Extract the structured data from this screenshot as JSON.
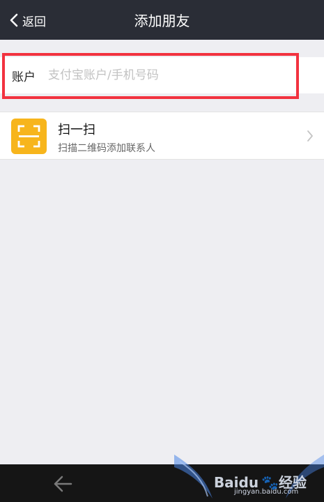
{
  "header": {
    "back_label": "返回",
    "title": "添加朋友"
  },
  "account": {
    "label": "账户",
    "placeholder": "支付宝账户/手机号码",
    "value": ""
  },
  "scan": {
    "title": "扫一扫",
    "subtitle": "扫描二维码添加联系人"
  },
  "watermark": {
    "brand": "Baidu",
    "suffix": "经验",
    "url": "jingyan.baidu.com"
  },
  "colors": {
    "header_bg": "#2a2d36",
    "scan_icon_bg": "#f7b51c",
    "highlight": "#f2323f",
    "page_bg": "#eeeef2"
  }
}
